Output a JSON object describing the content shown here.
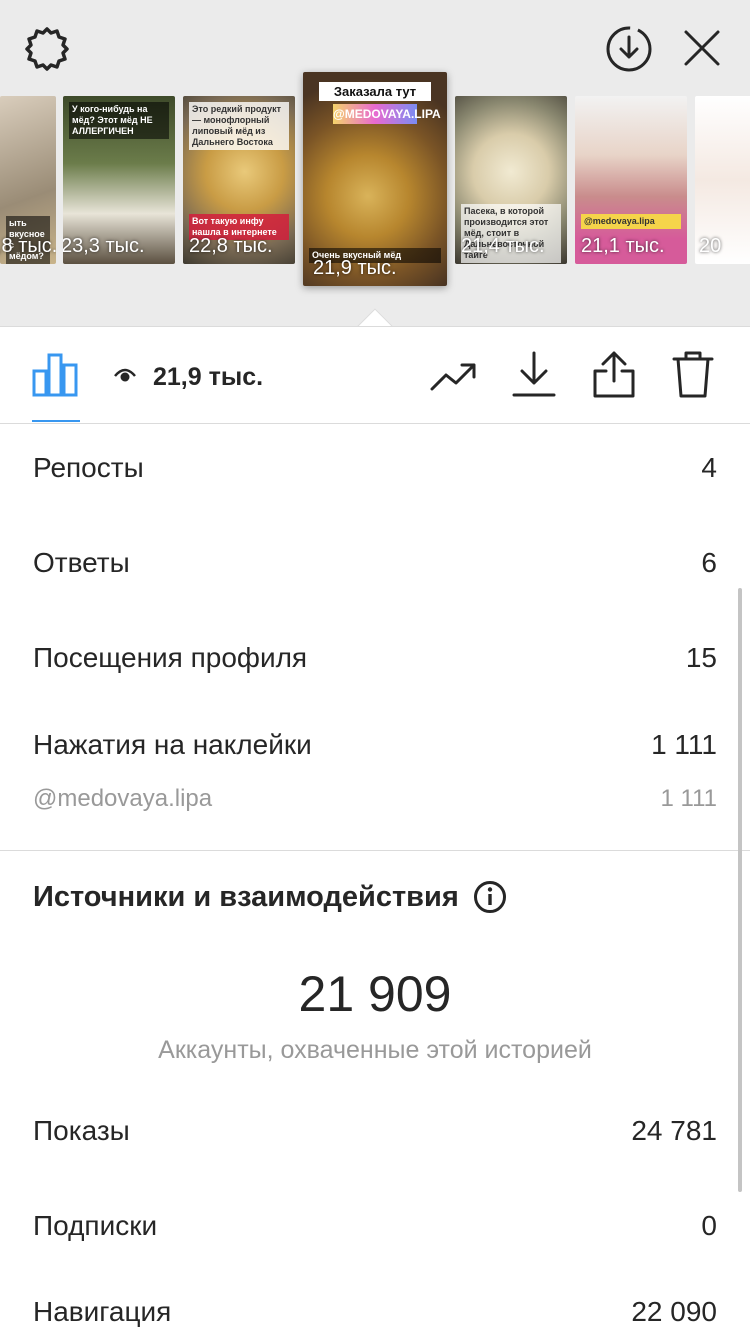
{
  "header": {
    "gear_icon": "gear-icon",
    "download_icon": "download-circle-icon",
    "close_icon": "close-icon"
  },
  "stories": [
    {
      "views": ",8 тыс.",
      "caption": "ыть вкусное с мёдом?"
    },
    {
      "views": "23,3 тыс.",
      "caption": "У кого-нибудь на мёд? Этот мёд НЕ АЛЛЕРГИЧЕН"
    },
    {
      "views": "22,8 тыс.",
      "caption": "Это редкий продукт — монофлорный липовый мёд из Дальнего Востока",
      "caption2": "Вот такую инфу нашла в интернете"
    },
    {
      "views": "21,9 тыс.",
      "title": "Заказала тут",
      "tag": "@MEDOVAYA.LIPA",
      "caption": "Очень вкусный мёд"
    },
    {
      "views": "21,4 тыс.",
      "caption": "Пасека, в которой производится этот мёд, стоит в Дальневосточной тайге"
    },
    {
      "views": "21,1 тыс.",
      "caption": "@medovaya.lipa"
    },
    {
      "views": "20",
      "caption": ""
    }
  ],
  "toolbar": {
    "views": "21,9 тыс.",
    "icons": [
      "bar-chart-icon",
      "eye-icon",
      "trend-icon",
      "download-icon",
      "share-icon",
      "trash-icon"
    ]
  },
  "metrics": [
    {
      "label": "Репосты",
      "value": "4"
    },
    {
      "label": "Ответы",
      "value": "6"
    },
    {
      "label": "Посещения профиля",
      "value": "15"
    },
    {
      "label": "Нажатия на наклейки",
      "value": "1 111"
    }
  ],
  "sticker": {
    "label": "@medovaya.lipa",
    "value": "1 111"
  },
  "sources": {
    "title": "Источники и взаимодействия",
    "reach": "21 909",
    "reach_label": "Аккаунты, охваченные этой историей",
    "rows": [
      {
        "label": "Показы",
        "value": "24 781"
      },
      {
        "label": "Подписки",
        "value": "0"
      },
      {
        "label": "Навигация",
        "value": "22 090"
      }
    ]
  },
  "colors": {
    "accent": "#3897f0",
    "text": "#262626",
    "muted": "#999999",
    "divider": "#dbdbdb",
    "top_bg": "#ebebeb"
  }
}
